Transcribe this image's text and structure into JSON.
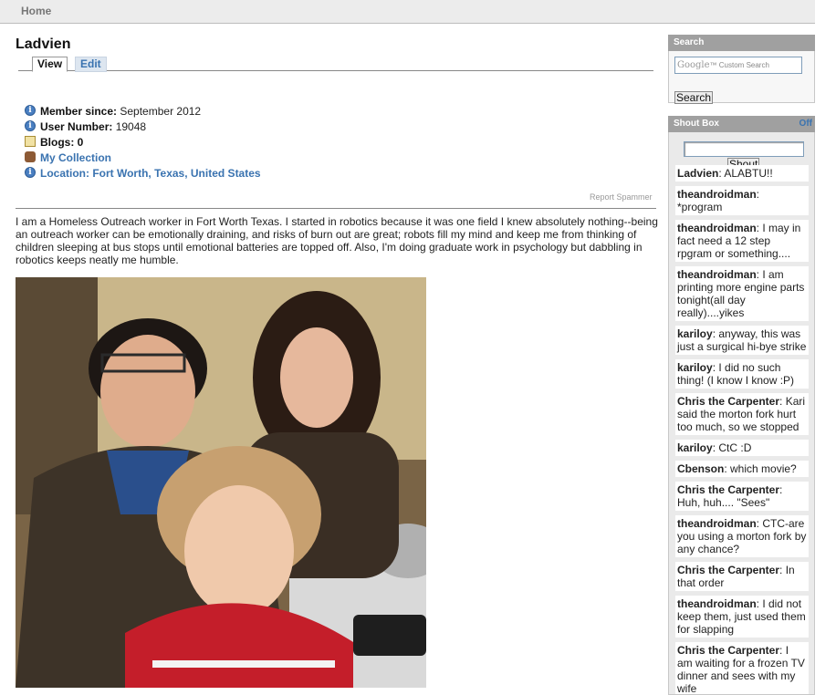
{
  "nav": {
    "home": "Home"
  },
  "profile": {
    "name": "Ladvien",
    "tabs": [
      {
        "label": "View"
      },
      {
        "label": "Edit"
      }
    ],
    "info": [
      {
        "label": "Member since:",
        "value": " September 2012",
        "icon": "info-icon"
      },
      {
        "label": "User Number:",
        "value": " 19048",
        "icon": "info-icon"
      },
      {
        "label": "Blogs:",
        "value": " 0",
        "icon": "blog-icon"
      },
      {
        "link": "My Collection",
        "icon": "collection-icon"
      },
      {
        "link": "Location: Fort Worth, Texas, United States",
        "icon": "info-icon"
      }
    ],
    "report": "Report Spammer",
    "bio": "I am a Homeless Outreach worker in Fort Worth Texas.  I started in robotics because it was one field I knew absolutely nothing--being an outreach worker can be emotionally draining, and risks of burn out are great; robots fill my mind and keep me from thinking of children sleeping at bus stops until emotional batteries are topped off.  Also, I'm doing graduate work in psychology but dabbling in robotics keeps neatly me humble."
  },
  "sidebar": {
    "search": {
      "title": "Search",
      "placeholder_brand": "Google",
      "placeholder_text": "Custom Search",
      "button": "Search"
    },
    "shoutbox": {
      "title": "Shout Box",
      "toggle": "Off",
      "button": "Shout",
      "messages": [
        {
          "user": "Ladvien",
          "text": ": ALABTU!!"
        },
        {
          "user": "theandroidman",
          "text": ": *program"
        },
        {
          "user": "theandroidman",
          "text": ": I may in fact need a 12 step rpgram or something...."
        },
        {
          "user": "theandroidman",
          "text": ": I am printing more engine parts tonight(all day really)....yikes"
        },
        {
          "user": "kariloy",
          "text": ": anyway, this was just a surgical hi-bye strike"
        },
        {
          "user": "kariloy",
          "text": ": I did no such thing! (I know I know :P)"
        },
        {
          "user": "Chris the Carpenter",
          "text": ": Kari said the morton fork hurt too much, so we stopped"
        },
        {
          "user": "kariloy",
          "text": ": CtC :D"
        },
        {
          "user": "Cbenson",
          "text": ": which movie?"
        },
        {
          "user": "Chris the Carpenter",
          "text": ": Huh, huh.... \"Sees\""
        },
        {
          "user": "theandroidman",
          "text": ": CTC-are you using a morton fork by any chance?"
        },
        {
          "user": "Chris the Carpenter",
          "text": ": In that order"
        },
        {
          "user": "theandroidman",
          "text": ": I did not keep them, just used them for slapping"
        },
        {
          "user": "Chris the Carpenter",
          "text": ": I am waiting for a frozen TV dinner and sees with my wife"
        }
      ]
    }
  },
  "colors": {
    "link": "#3a73b0",
    "sidebar_header": "#a0a0a0",
    "tab_edit_bg": "#dde6f0"
  }
}
